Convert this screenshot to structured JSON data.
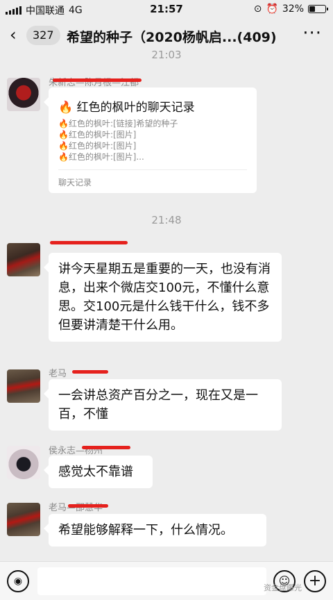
{
  "status_bar": {
    "carrier": "中国联通",
    "network": "4G",
    "time": "21:57",
    "battery": "32%",
    "battery_level": 0.32
  },
  "header": {
    "back_icon": "‹",
    "unread_count": "327",
    "title": "希望的种子（2020杨帆启...(409)",
    "more_icon": "···"
  },
  "timestamps": [
    "21:03",
    "21:48"
  ],
  "messages": [
    {
      "type": "card",
      "sender": "朱新志—陈月根—江都",
      "card_title": "红色的枫叶的聊天记录",
      "card_lines": [
        "红色的枫叶:[链接]希望的种子",
        "红色的枫叶:[图片]",
        "红色的枫叶:[图片]",
        "红色的枫叶:[图片]..."
      ],
      "card_footer": "聊天记录"
    },
    {
      "type": "text",
      "sender": "",
      "text": "讲今天星期五是重要的一天，也没有消息，出来个微店交100元，不懂什么意思。交100元是什么钱干什么，钱不多但要讲清楚干什么用。"
    },
    {
      "type": "text",
      "sender": "老马",
      "text": "一会讲总资产百分之一，现在又是一百，不懂"
    },
    {
      "type": "text",
      "sender": "侯永志—杨州",
      "text": "感觉太不靠谱"
    },
    {
      "type": "text",
      "sender": "老马—邵慧华",
      "text": "希望能够解释一下，什么情况。"
    }
  ],
  "input_bar": {
    "voice_icon": "voice-icon",
    "emoji_icon": "emoji-icon",
    "plus_icon": "plus-icon",
    "watermark": "资金盘曝光"
  },
  "colors": {
    "redaction": "#e5211d",
    "background": "#ededed",
    "bubble": "#ffffff"
  }
}
